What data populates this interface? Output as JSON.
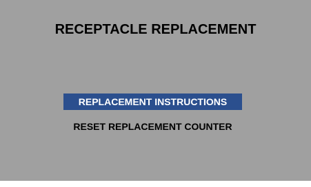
{
  "screen": {
    "title": "RECEPTACLE REPLACEMENT",
    "background_color": "#a0a0a0"
  },
  "menu": {
    "items": [
      {
        "label": "REPLACEMENT INSTRUCTIONS",
        "selected": true
      },
      {
        "label": "RESET REPLACEMENT COUNTER",
        "selected": false
      }
    ],
    "highlight_color": "#2b4f8e"
  }
}
